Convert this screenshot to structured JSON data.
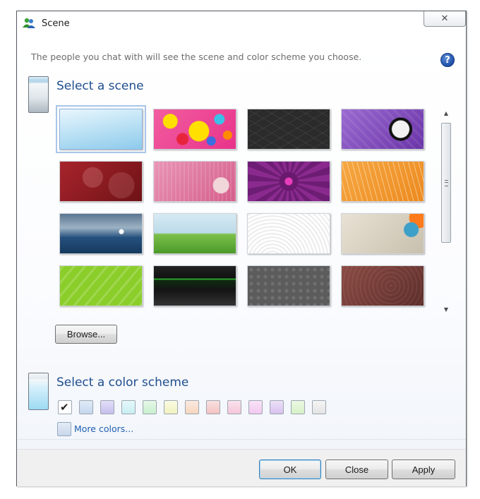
{
  "window": {
    "title": "Scene",
    "close_glyph": "✕"
  },
  "intro_text": "The people you chat with will see the scene and color scheme you choose.",
  "help_icon": {
    "glyph": "?",
    "name": "help-icon"
  },
  "scene_section": {
    "heading": "Select a scene"
  },
  "scenes": [
    {
      "name": "light-blue-sky",
      "selected": true
    },
    {
      "name": "colorful-doodles",
      "selected": false
    },
    {
      "name": "dark-geometric",
      "selected": false
    },
    {
      "name": "purple-skull",
      "selected": false
    },
    {
      "name": "red-love-swirls",
      "selected": false
    },
    {
      "name": "pink-hearts",
      "selected": false
    },
    {
      "name": "purple-heart-burst",
      "selected": false
    },
    {
      "name": "orange-trees",
      "selected": false
    },
    {
      "name": "ocean-rocket",
      "selected": false
    },
    {
      "name": "green-field-bird",
      "selected": false
    },
    {
      "name": "white-waves",
      "selected": false
    },
    {
      "name": "grunge-chameleon",
      "selected": false
    },
    {
      "name": "lime-stripes",
      "selected": false
    },
    {
      "name": "black-green-glow",
      "selected": false
    },
    {
      "name": "gray-damask",
      "selected": false
    },
    {
      "name": "brown-swirls",
      "selected": false
    }
  ],
  "browse_label": "Browse...",
  "color_section": {
    "heading": "Select a color scheme"
  },
  "color_swatches": [
    {
      "color": "#ffffff",
      "selected": true
    },
    {
      "color": "#c5d6ee",
      "selected": false
    },
    {
      "color": "#c6bfee",
      "selected": false
    },
    {
      "color": "#c8eef3",
      "selected": false
    },
    {
      "color": "#c9efce",
      "selected": false
    },
    {
      "color": "#f2f2c0",
      "selected": false
    },
    {
      "color": "#f6d6bf",
      "selected": false
    },
    {
      "color": "#f4c2c2",
      "selected": false
    },
    {
      "color": "#f5c6d9",
      "selected": false
    },
    {
      "color": "#f2c8f0",
      "selected": false
    },
    {
      "color": "#d8c2ef",
      "selected": false
    },
    {
      "color": "#d7f1c7",
      "selected": false
    },
    {
      "color": "#e4e4e4",
      "selected": false
    }
  ],
  "more_colors_label": "More colors...",
  "buttons": {
    "ok": "OK",
    "close": "Close",
    "apply": "Apply"
  }
}
